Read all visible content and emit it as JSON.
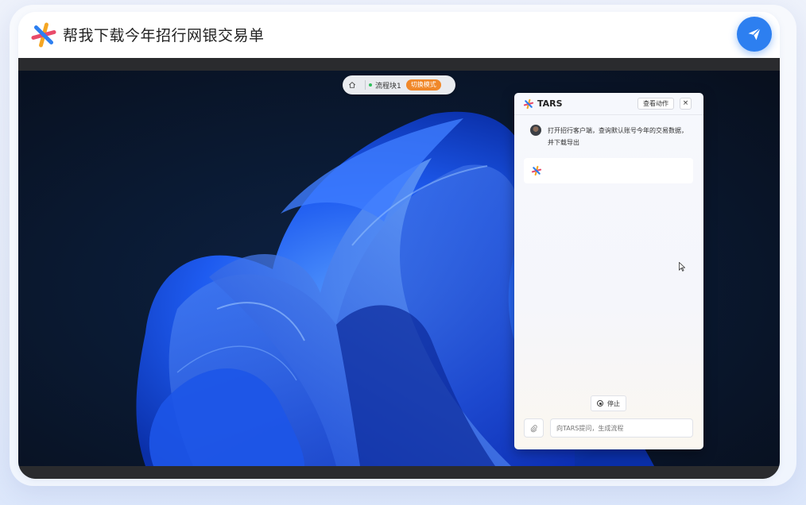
{
  "header": {
    "title": "帮我下载今年招行网银交易单",
    "logo_icon": "tars-logo-icon",
    "send_icon": "send-icon",
    "accent": "#2d7ff0"
  },
  "toolbar": {
    "home_icon": "home-icon",
    "flow_label": "流程块1",
    "status_color": "#2fbf5b",
    "switch_label": "切换模式",
    "switch_color": "#f0882a"
  },
  "panel": {
    "title": "TARS",
    "view_actions_label": "查看动作",
    "close_label": "×",
    "user_message": "打开招行客户端，查询默认账号今年的交易数据，并下载导出",
    "stop_label": "停止",
    "input_placeholder": "向TARS提问，生成流程"
  }
}
